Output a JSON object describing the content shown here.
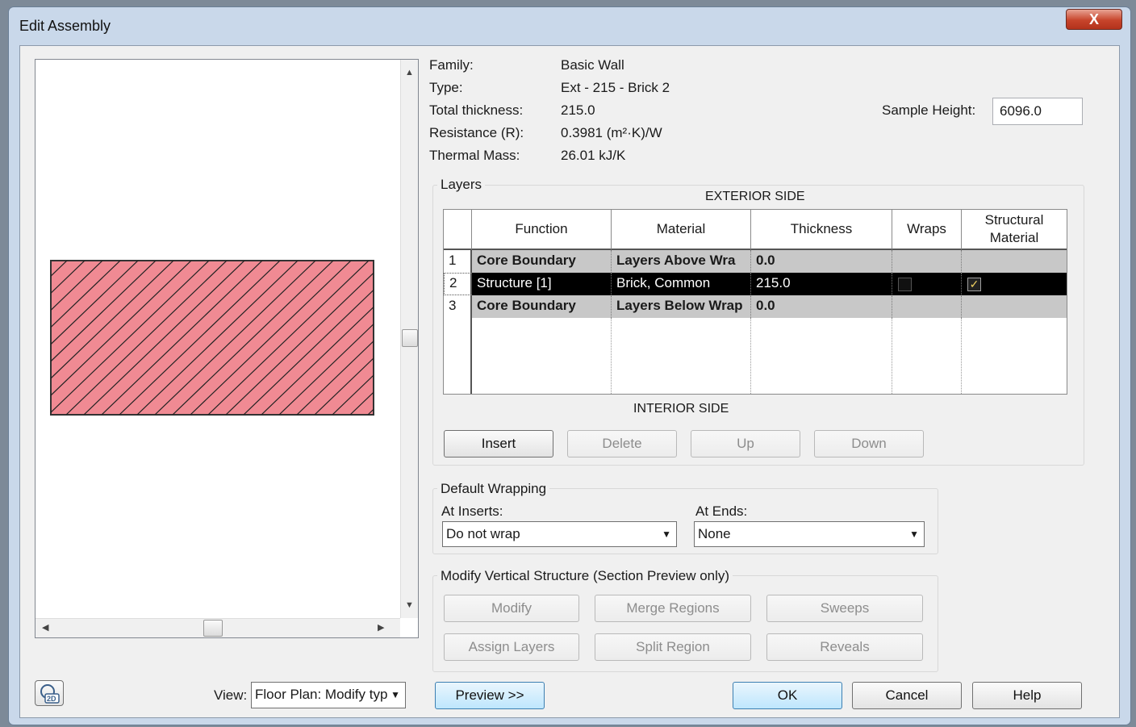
{
  "window": {
    "title": "Edit Assembly",
    "close_glyph": "X"
  },
  "info": {
    "family_label": "Family:",
    "family_value": "Basic Wall",
    "type_label": "Type:",
    "type_value": "Ext - 215 - Brick 2",
    "thickness_label": "Total thickness:",
    "thickness_value": "215.0",
    "resistance_label": "Resistance (R):",
    "resistance_value": "0.3981 (m²·K)/W",
    "thermal_label": "Thermal Mass:",
    "thermal_value": "26.01 kJ/K",
    "sample_height_label": "Sample Height:",
    "sample_height_value": "6096.0"
  },
  "layers": {
    "group_title": "Layers",
    "exterior_label": "EXTERIOR SIDE",
    "interior_label": "INTERIOR SIDE",
    "columns": [
      "Function",
      "Material",
      "Thickness",
      "Wraps",
      "Structural Material"
    ],
    "rows": [
      {
        "num": "1",
        "function": "Core Boundary",
        "material": "Layers Above Wra",
        "thickness": "0.0",
        "wraps": false,
        "structural": false
      },
      {
        "num": "2",
        "function": "Structure [1]",
        "material": "Brick, Common",
        "thickness": "215.0",
        "wraps": false,
        "structural": true
      },
      {
        "num": "3",
        "function": "Core Boundary",
        "material": "Layers Below Wrap",
        "thickness": "0.0",
        "wraps": false,
        "structural": false
      }
    ],
    "insert_label": "Insert",
    "delete_label": "Delete",
    "up_label": "Up",
    "down_label": "Down"
  },
  "wrapping": {
    "group_title": "Default Wrapping",
    "at_inserts_label": "At Inserts:",
    "at_inserts_value": "Do not wrap",
    "at_ends_label": "At Ends:",
    "at_ends_value": "None"
  },
  "vertical": {
    "group_title": "Modify Vertical Structure (Section Preview only)",
    "modify_label": "Modify",
    "merge_label": "Merge Regions",
    "sweeps_label": "Sweeps",
    "assign_label": "Assign Layers",
    "split_label": "Split Region",
    "reveals_label": "Reveals"
  },
  "footer": {
    "view_label": "View:",
    "view_value": "Floor Plan: Modify typ",
    "preview_label": "Preview >>",
    "ok_label": "OK",
    "cancel_label": "Cancel",
    "help_label": "Help"
  },
  "colors": {
    "wall_fill": "#f08a93",
    "selected_row": "#000000",
    "boundary_row": "#c8c8c8"
  }
}
